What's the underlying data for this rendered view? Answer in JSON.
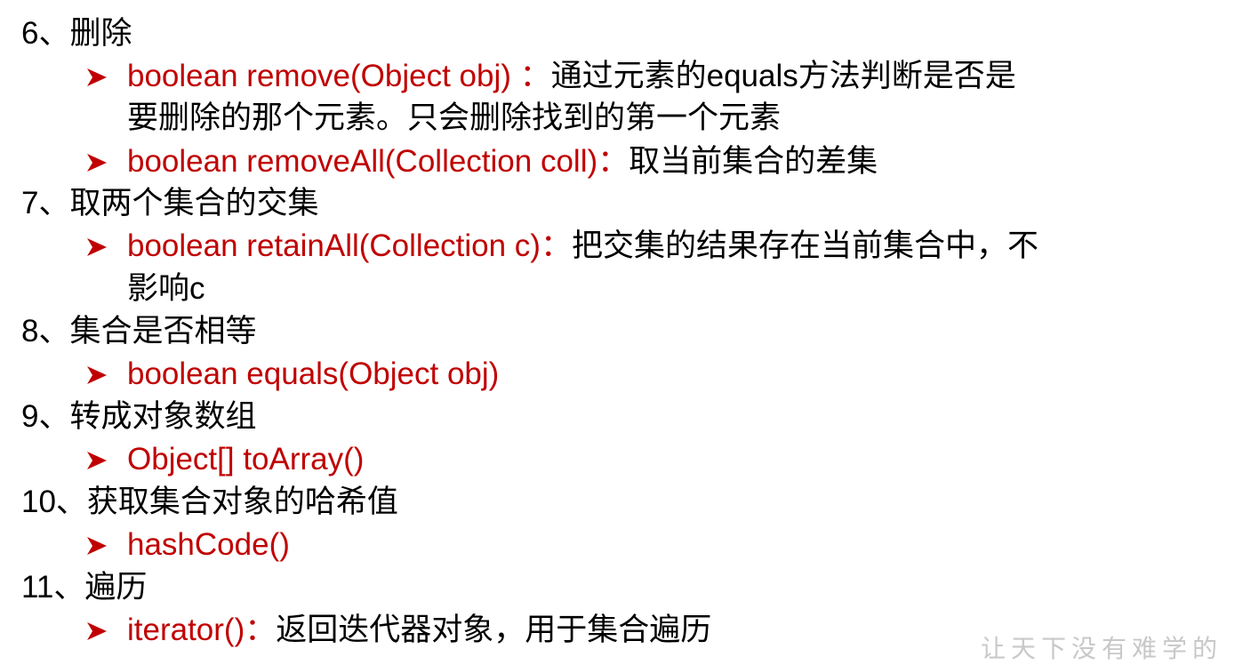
{
  "sections": [
    {
      "heading": "6、删除",
      "items": [
        {
          "code": "boolean remove(Object obj) ：",
          "desc": "通过元素的equals方法判断是否是",
          "desc_cont": "要删除的那个元素。只会删除找到的第一个元素"
        },
        {
          "code": "boolean removeAll(Collection coll)：",
          "desc": "取当前集合的差集"
        }
      ]
    },
    {
      "heading": "7、取两个集合的交集",
      "items": [
        {
          "code": "boolean retainAll(Collection c)：",
          "desc": "把交集的结果存在当前集合中，不",
          "desc_cont": "影响c"
        }
      ]
    },
    {
      "heading": "8、集合是否相等",
      "items": [
        {
          "code": "boolean equals(Object obj)"
        }
      ]
    },
    {
      "heading": "9、转成对象数组",
      "items": [
        {
          "code": "Object[] toArray()"
        }
      ]
    },
    {
      "heading": "10、获取集合对象的哈希值",
      "items": [
        {
          "code": "hashCode()"
        }
      ]
    },
    {
      "heading": "11、遍历",
      "items": [
        {
          "code": "iterator()：",
          "desc": "返回迭代器对象，用于集合遍历"
        }
      ]
    }
  ],
  "watermark": "让天下没有难学的",
  "colors": {
    "code": "#c00000",
    "bullet": "#c00000",
    "text": "#000000"
  },
  "icons": {
    "bullet": "arrow-bullet-icon"
  }
}
